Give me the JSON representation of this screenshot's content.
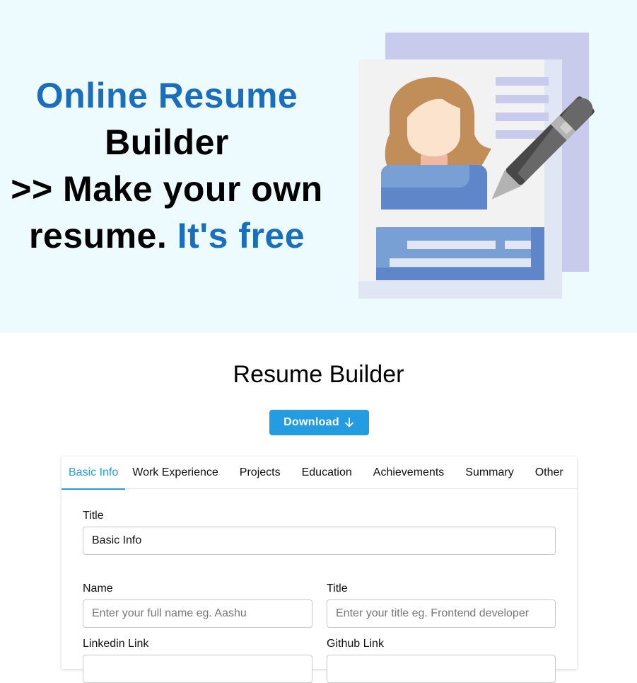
{
  "hero": {
    "line1": "Online Resume",
    "line2": "Builder",
    "line3": ">> Make your own",
    "line4_black": "resume.",
    "line4_blue": "It's free",
    "illustration": "resume-with-pen-illustration"
  },
  "main": {
    "title": "Resume Builder",
    "download_label": "Download",
    "download_icon": "arrow-down-icon"
  },
  "tabs": [
    {
      "label": "Basic Info",
      "active": true
    },
    {
      "label": "Work Experience",
      "active": false
    },
    {
      "label": "Projects",
      "active": false
    },
    {
      "label": "Education",
      "active": false
    },
    {
      "label": "Achievements",
      "active": false
    },
    {
      "label": "Summary",
      "active": false
    },
    {
      "label": "Other",
      "active": false
    }
  ],
  "form": {
    "section_title_label": "Title",
    "section_title_value": "Basic Info",
    "name_label": "Name",
    "name_placeholder": "Enter your full name eg. Aashu",
    "title_label": "Title",
    "title_placeholder": "Enter your title eg. Frontend developer",
    "linkedin_label": "Linkedin Link",
    "github_label": "Github Link"
  },
  "colors": {
    "accent": "#239ce2",
    "hero_blue": "#1a6fbd",
    "hero_bg": "#edfbff"
  }
}
